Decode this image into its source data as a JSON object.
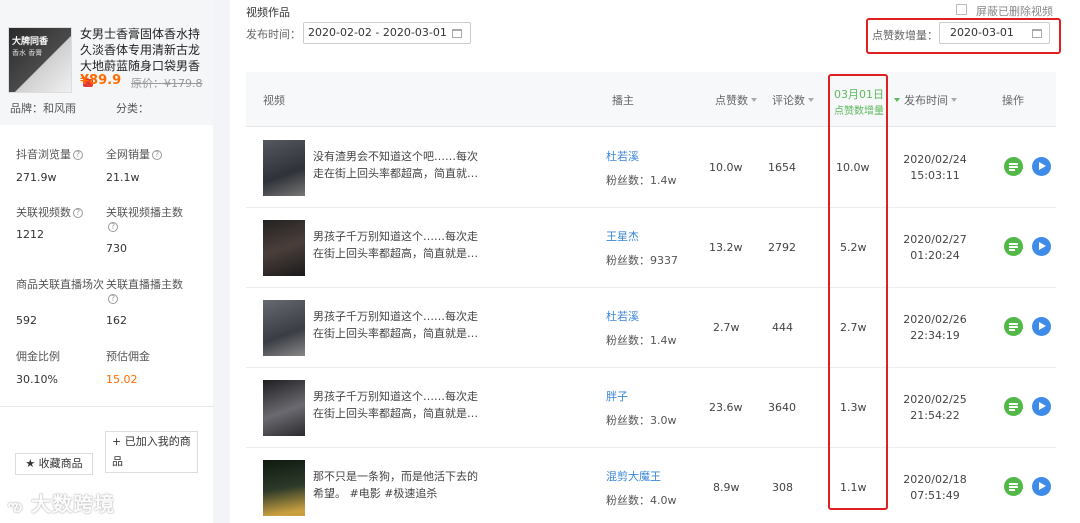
{
  "product": {
    "image_text": "大牌同香",
    "image_subtext": "香水 香膏",
    "title": "女男士香膏固体香水持久淡香体专用清新古龙大地蔚蓝随身口袋男香",
    "price": "¥89.9",
    "original_price": "原价：¥179.8",
    "brand": "品牌：和风雨",
    "category": "分类："
  },
  "stats": [
    {
      "label": "抖音浏览量",
      "value": "271.9w"
    },
    {
      "label": "全网销量",
      "value": "21.1w"
    },
    {
      "label": "关联视频数",
      "value": "1212"
    },
    {
      "label": "关联视频播主数",
      "value": "730"
    },
    {
      "label": "商品关联直播场次",
      "value": "592"
    },
    {
      "label": "关联直播播主数",
      "value": "162"
    },
    {
      "label": "佣金比例",
      "value": "30.10%"
    },
    {
      "label": "预估佣金",
      "value": "15.02"
    }
  ],
  "actions": {
    "added": "+ 已加入我的商品",
    "favorite": "★ 收藏商品"
  },
  "watermark": "大数跨境",
  "videos": {
    "section_title": "视频作品",
    "publish_time_label": "发布时间：",
    "date_range": "2020-02-02 - 2020-03-01",
    "hide_deleted_label": "屏蔽已删除视频",
    "like_increment_label": "点赞数增量：",
    "like_increment_date": "2020-03-01",
    "columns": {
      "video": "视频",
      "author": "播主",
      "likes": "点赞数",
      "comments": "评论数",
      "increment_date": "03月01日",
      "increment_label": "点赞数增量",
      "publish_time": "发布时间",
      "ops": "操作"
    },
    "rows": [
      {
        "title": "没有渣男会不知道这个吧……每次走在街上回头率都超高，简直就…",
        "author": "杜若溪",
        "fans": "粉丝数：1.4w",
        "likes": "10.0w",
        "comments": "1654",
        "increment": "10.0w",
        "date": "2020/02/24",
        "time": "15:03:11"
      },
      {
        "title": "男孩子千万别知道这个……每次走在街上回头率都超高，简直就是…",
        "author": "王星杰",
        "fans": "粉丝数：9337",
        "likes": "13.2w",
        "comments": "2792",
        "increment": "5.2w",
        "date": "2020/02/27",
        "time": "01:20:24"
      },
      {
        "title": "男孩子千万别知道这个……每次走在街上回头率都超高，简直就是…",
        "author": "杜若溪",
        "fans": "粉丝数：1.4w",
        "likes": "2.7w",
        "comments": "444",
        "increment": "2.7w",
        "date": "2020/02/26",
        "time": "22:34:19"
      },
      {
        "title": "男孩子千万别知道这个……每次走在街上回头率都超高，简直就是…",
        "author": "胖子",
        "fans": "粉丝数：3.0w",
        "likes": "23.6w",
        "comments": "3640",
        "increment": "1.3w",
        "date": "2020/02/25",
        "time": "21:54:22"
      },
      {
        "title": "那不只是一条狗，而是他活下去的希望。 #电影 #极速追杀",
        "author": "混剪大魔王",
        "fans": "粉丝数：4.0w",
        "likes": "8.9w",
        "comments": "308",
        "increment": "1.1w",
        "date": "2020/02/18",
        "time": "07:51:49"
      }
    ]
  },
  "colors": {
    "accent_orange": "#ff6b00",
    "link_blue": "#3a86d6",
    "highlight_red": "#e02020",
    "green": "#52b848",
    "blue": "#3e8ce8"
  }
}
